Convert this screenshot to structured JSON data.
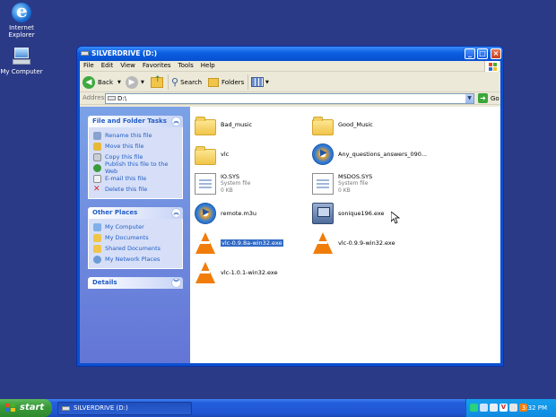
{
  "desktop": {
    "icons": [
      {
        "label": "Internet Explorer"
      },
      {
        "label": "My Computer"
      }
    ]
  },
  "window": {
    "title": "SILVERDRIVE (D:)",
    "menu": [
      "File",
      "Edit",
      "View",
      "Favorites",
      "Tools",
      "Help"
    ],
    "toolbar": {
      "back_label": "Back",
      "search_label": "Search",
      "folders_label": "Folders"
    },
    "address": {
      "label": "Address",
      "value": "D:\\",
      "go_label": "Go"
    },
    "taskpane": {
      "file_tasks_title": "File and Folder Tasks",
      "file_tasks": [
        "Rename this file",
        "Move this file",
        "Copy this file",
        "Publish this file to the Web",
        "E-mail this file",
        "Delete this file"
      ],
      "other_places_title": "Other Places",
      "other_places": [
        "My Computer",
        "My Documents",
        "Shared Documents",
        "My Network Places"
      ],
      "details_title": "Details"
    },
    "files": [
      {
        "name": "Bad_music"
      },
      {
        "name": "Good_Music"
      },
      {
        "name": "vlc"
      },
      {
        "name": "Any_questions_answers_090..."
      },
      {
        "name": "IO.SYS",
        "type": "System file",
        "size": "0 KB"
      },
      {
        "name": "MSDOS.SYS",
        "type": "System file",
        "size": "0 KB"
      },
      {
        "name": "remote.m3u"
      },
      {
        "name": "sonique196.exe"
      },
      {
        "name": "vlc-0.9.8a-win32.exe"
      },
      {
        "name": "vlc-0.9.9-win32.exe"
      },
      {
        "name": "vlc-1.0.1-win32.exe"
      }
    ]
  },
  "taskbar": {
    "start_label": "start",
    "task_title": "SILVERDRIVE (D:)",
    "clock": "3:32 PM"
  }
}
